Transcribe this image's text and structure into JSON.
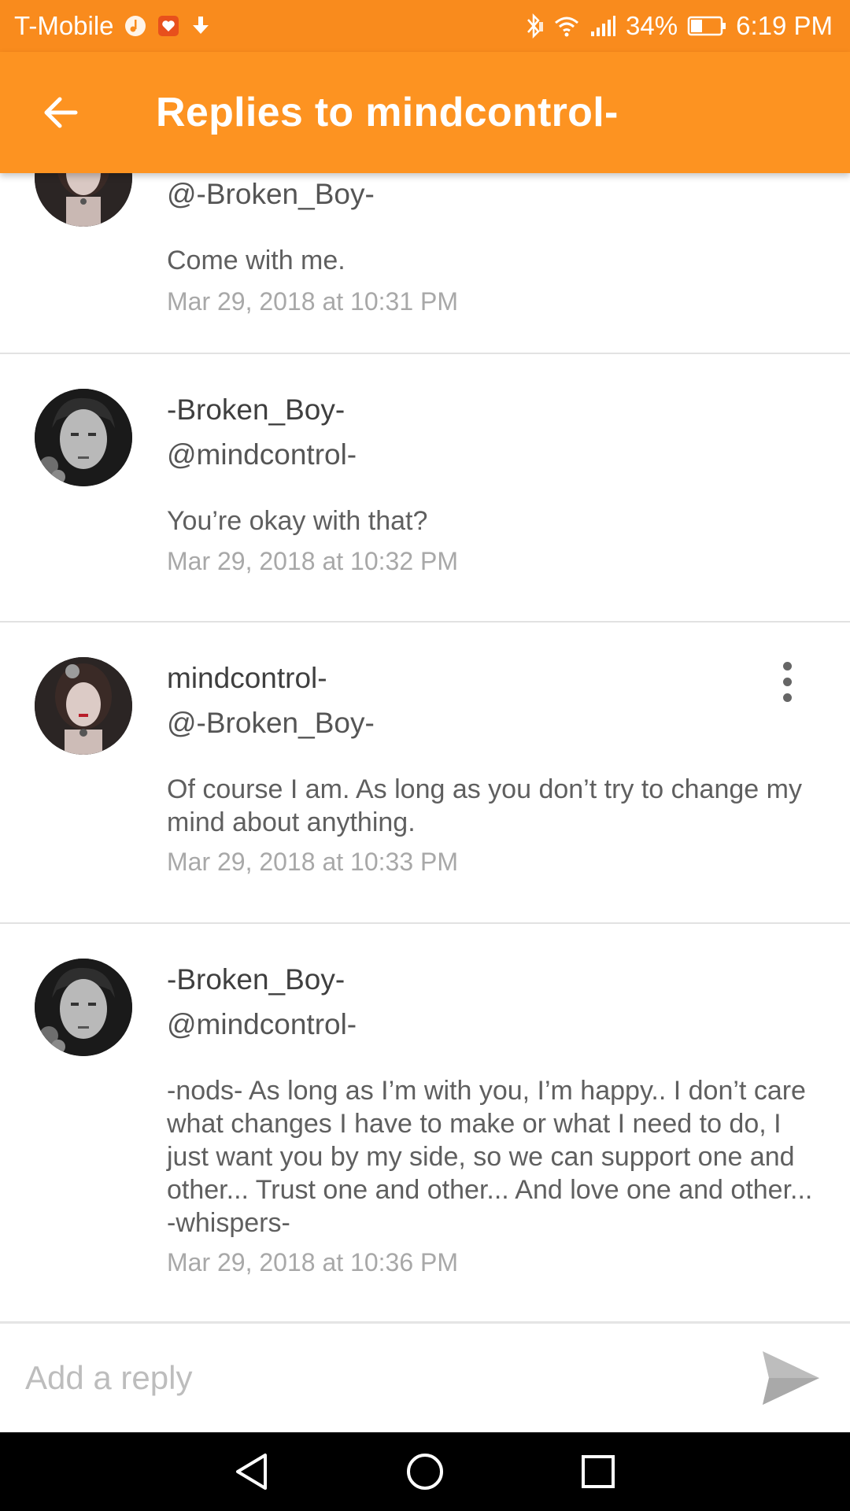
{
  "status_bar": {
    "carrier": "T-Mobile",
    "battery": "34%",
    "time": "6:19 PM"
  },
  "app_bar": {
    "title": "Replies to mindcontrol-",
    "back_icon": "arrow-left-icon"
  },
  "replies": [
    {
      "author": "",
      "mention": "@-Broken_Boy-",
      "text": "Come with me.",
      "timestamp": "Mar 29, 2018 at 10:31 PM",
      "avatar": "girl-avatar"
    },
    {
      "author": "-Broken_Boy-",
      "mention": "@mindcontrol-",
      "text": "You’re okay with that?",
      "timestamp": "Mar 29, 2018 at 10:32 PM",
      "avatar": "boy-avatar"
    },
    {
      "author": "mindcontrol-",
      "mention": "@-Broken_Boy-",
      "text": "Of course I am. As long as you don’t try to change my mind about anything.",
      "timestamp": "Mar 29, 2018 at 10:33 PM",
      "avatar": "girl-avatar",
      "has_menu": true
    },
    {
      "author": "-Broken_Boy-",
      "mention": "@mindcontrol-",
      "text": "-nods- As long as I’m with you, I’m happy.. I don’t care what changes I have to make or what I need to do, I just want you by my side, so we can support one and other...  Trust one and other... And love one and other... -whispers-",
      "timestamp": "Mar 29, 2018 at 10:36 PM",
      "avatar": "boy-avatar"
    }
  ],
  "composer": {
    "placeholder": "Add a reply",
    "value": "",
    "send_icon": "send-icon"
  },
  "colors": {
    "status_bar": "#f98b1d",
    "app_bar": "#fd9321",
    "divider": "#e2e2e2",
    "timestamp": "#a8a8a8"
  }
}
